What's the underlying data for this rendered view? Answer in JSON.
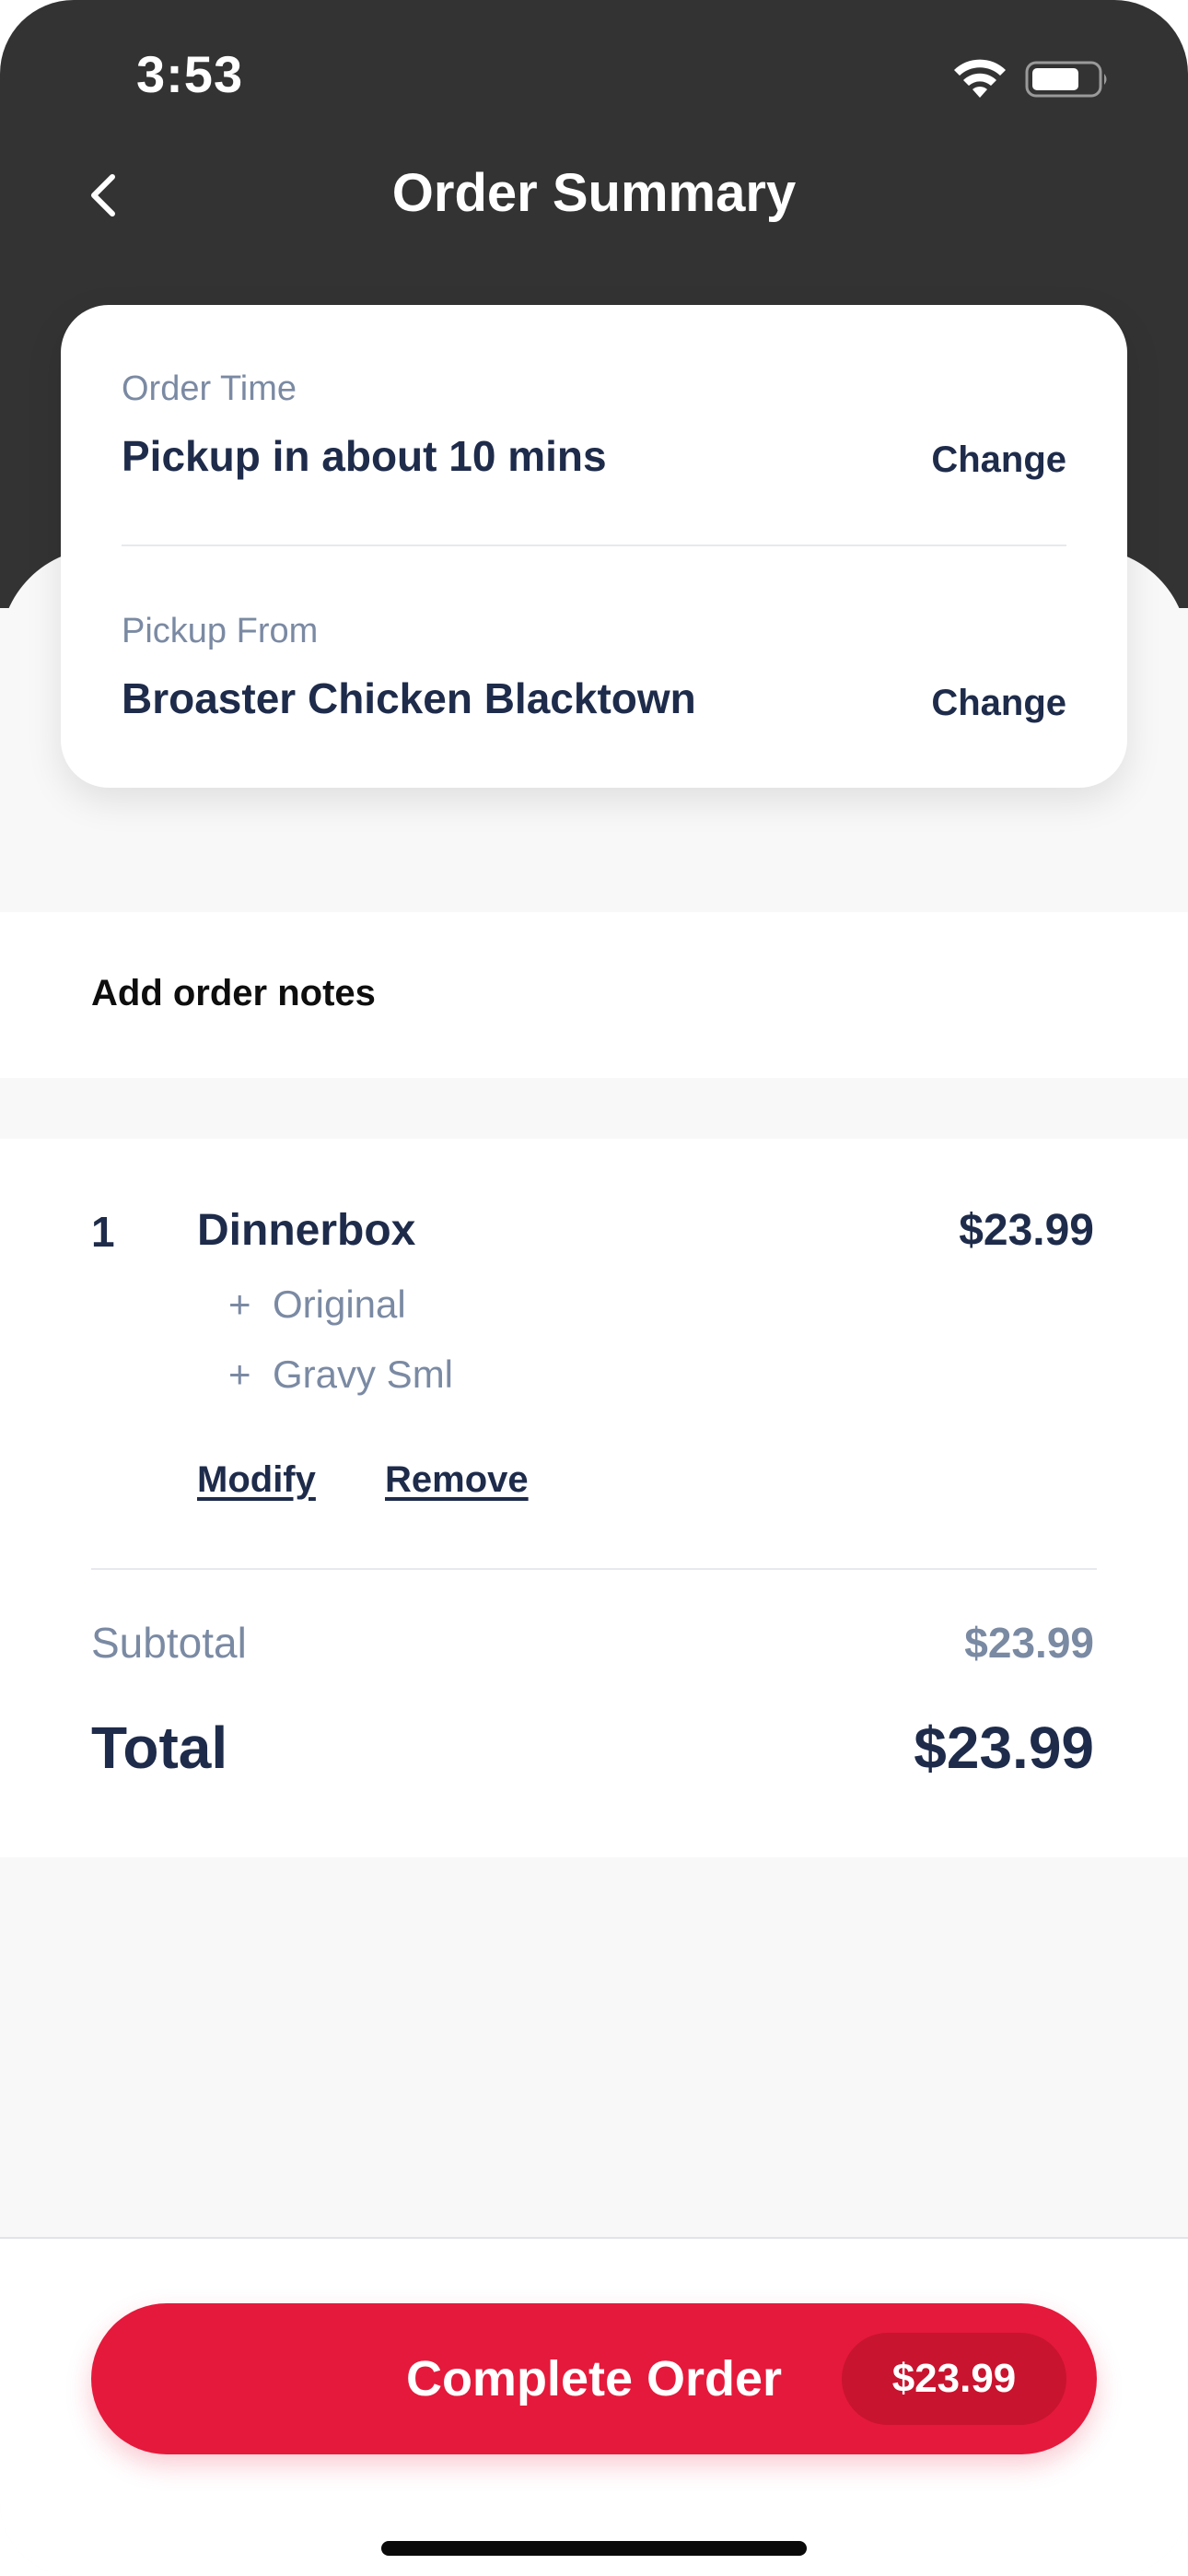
{
  "status_bar": {
    "time": "3:53",
    "icons": [
      "wifi-icon",
      "battery-icon"
    ]
  },
  "header": {
    "title": "Order Summary",
    "back_icon": "chevron-left-icon"
  },
  "order_info": {
    "order_time": {
      "label": "Order Time",
      "value": "Pickup in about 10 mins",
      "action": "Change"
    },
    "pickup_from": {
      "label": "Pickup From",
      "value": "Broaster Chicken Blacktown",
      "action": "Change"
    }
  },
  "notes": {
    "label": "Add order notes"
  },
  "items": [
    {
      "qty": "1",
      "name": "Dinnerbox",
      "price": "$23.99",
      "modifiers": [
        {
          "symbol": "+",
          "label": "Original"
        },
        {
          "symbol": "+",
          "label": "Gravy Sml"
        }
      ],
      "modify_label": "Modify",
      "remove_label": "Remove"
    }
  ],
  "summary": {
    "subtotal_label": "Subtotal",
    "subtotal_value": "$23.99",
    "total_label": "Total",
    "total_value": "$23.99"
  },
  "checkout": {
    "button_label": "Complete Order",
    "button_price": "$23.99"
  },
  "colors": {
    "header_bg": "#333333",
    "accent": "#e5193b",
    "primary_text": "#1e2b4a",
    "secondary_text": "#7b8aa3"
  }
}
